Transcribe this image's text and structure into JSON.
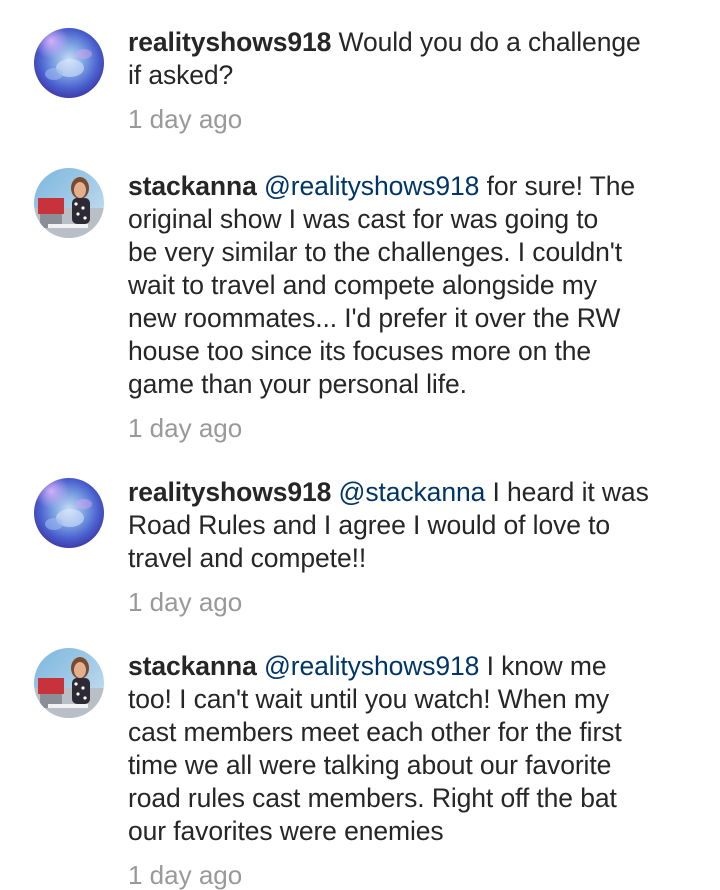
{
  "comments": [
    {
      "username": "realityshows918",
      "mention": "",
      "lines": [
        "Would you do a challenge",
        "if asked?"
      ],
      "timestamp": "1 day ago",
      "avatar": "galaxy-avatar"
    },
    {
      "username": "stackanna",
      "mention": "@realityshows918",
      "lines": [
        "for sure! The",
        "original show I was cast for was going to",
        "be very similar to the challenges. I couldn't",
        "wait to travel and compete alongside my",
        "new roommates... I'd prefer it over the RW",
        "house too since its focuses more on the",
        "game than your personal life."
      ],
      "timestamp": "1 day ago",
      "avatar": "photo-avatar"
    },
    {
      "username": "realityshows918",
      "mention": "@stackanna",
      "lines": [
        "I heard it was",
        "Road Rules and I agree I would of love to",
        "travel and compete!!"
      ],
      "timestamp": "1 day ago",
      "avatar": "galaxy-avatar"
    },
    {
      "username": "stackanna",
      "mention": "@realityshows918",
      "lines": [
        "I know me",
        "too! I can't wait until you watch! When my",
        "cast members meet each other for the first",
        "time we all were talking about our favorite",
        "road rules cast members. Right off the bat",
        "our favorites were enemies"
      ],
      "timestamp": "1 day ago",
      "avatar": "photo-avatar"
    }
  ],
  "colors": {
    "text": "#262626",
    "mention": "#003569",
    "timestamp": "#999999",
    "background": "#ffffff"
  }
}
